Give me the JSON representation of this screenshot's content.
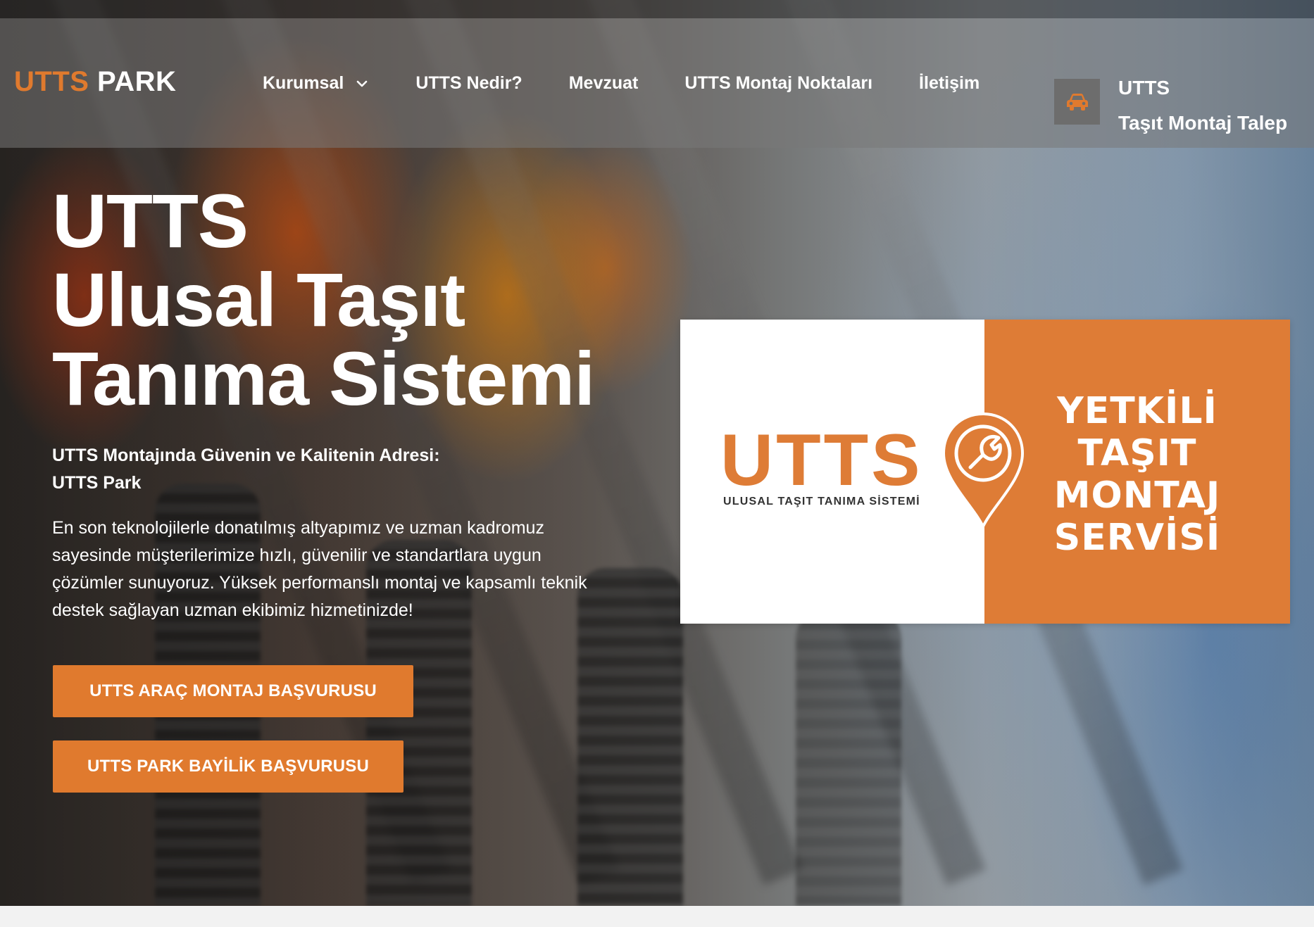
{
  "logo": {
    "part1": "UTTS",
    "part2": " PARK"
  },
  "nav": {
    "items": [
      {
        "label": "Kurumsal"
      },
      {
        "label": "UTTS Nedir?"
      },
      {
        "label": "Mevzuat"
      },
      {
        "label": "UTTS Montaj Noktaları"
      },
      {
        "label": "İletişim"
      }
    ]
  },
  "cta": {
    "line1": "UTTS",
    "line2": "Taşıt Montaj Talep",
    "icon": "car-icon"
  },
  "hero": {
    "title_line1": "UTTS",
    "title_line2": "Ulusal Taşıt",
    "title_line3": "Tanıma Sistemi",
    "subtitle_line1": "UTTS Montajında Güvenin ve Kalitenin Adresi:",
    "subtitle_line2": "UTTS Park",
    "paragraph": "En son teknolojilerle donatılmış altyapımız ve uzman kadromuz sayesinde müşterilerimize hızlı, güvenilir ve standartlara uygun çözümler sunuyoruz. Yüksek performanslı montaj ve kapsamlı teknik destek sağlayan uzman ekibimiz hizmetinizde!",
    "button1": "UTTS ARAÇ MONTAJ BAŞVURUSU",
    "button2": "UTTS PARK BAYİLİK BAŞVURUSU"
  },
  "brand_card": {
    "logo_text": "UTTS",
    "logo_subtext": "ULUSAL TAŞIT TANIMA SİSTEMİ",
    "slogan_line1": "YETKİLİ",
    "slogan_line2": "TAŞIT",
    "slogan_line3": "MONTAJ",
    "slogan_line4": "SERVİSİ",
    "icon": "wrench-pin-icon"
  },
  "colors": {
    "accent": "#e07a2e",
    "card_orange": "#de7c36"
  }
}
